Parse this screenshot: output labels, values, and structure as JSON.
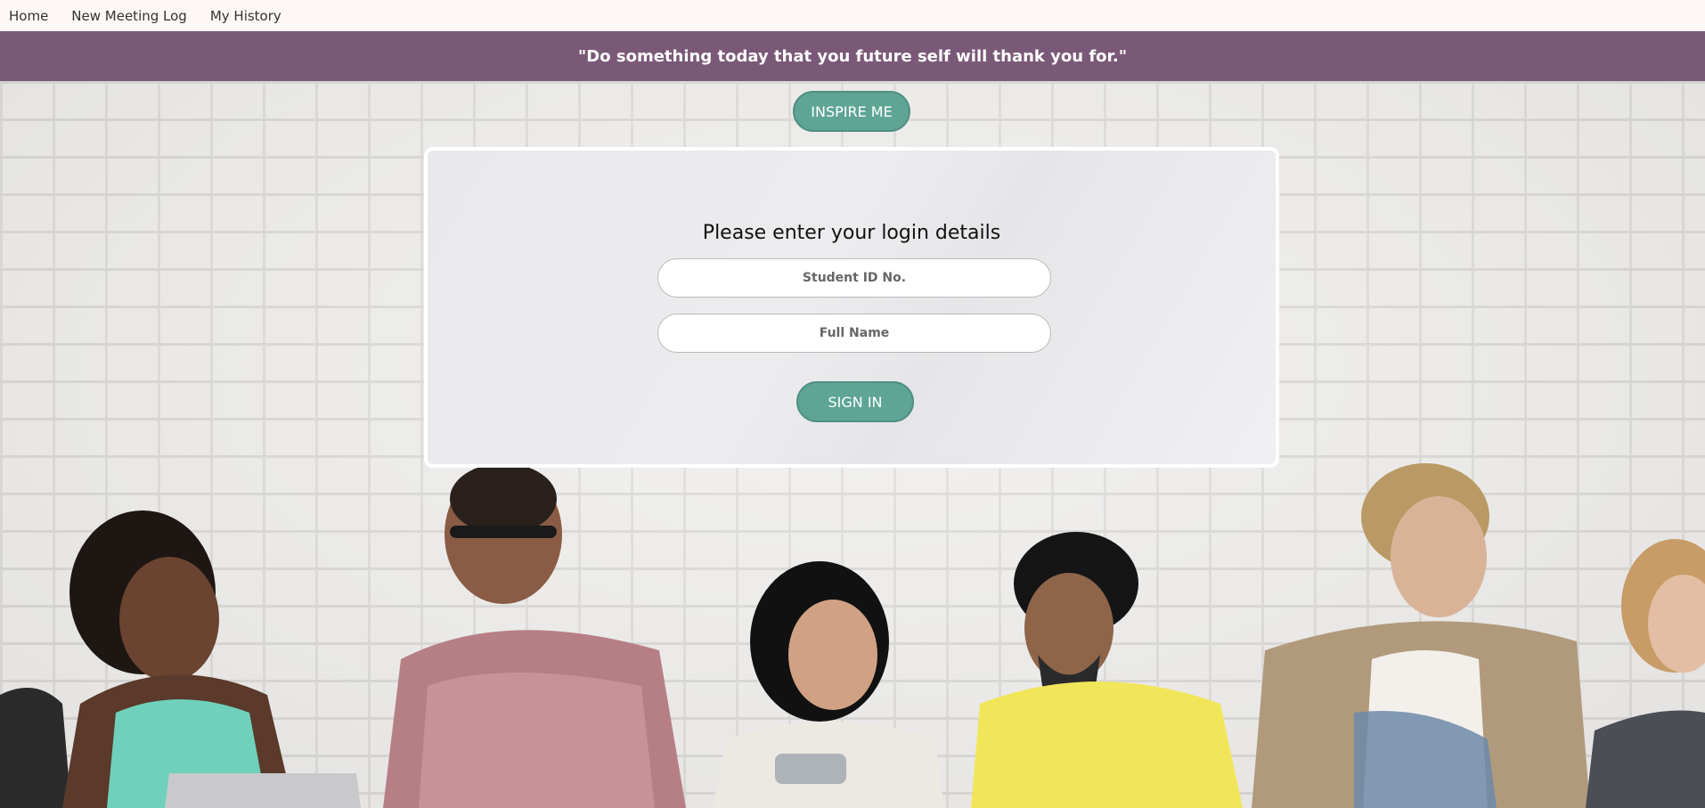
{
  "nav": {
    "items": [
      "Home",
      "New Meeting Log",
      "My History"
    ]
  },
  "quote": {
    "text": "\"Do something today that you future self will thank you for.\""
  },
  "inspire": {
    "label": "INSPIRE ME"
  },
  "login": {
    "title": "Please enter your login details",
    "student_id_placeholder": "Student ID No.",
    "full_name_placeholder": "Full Name",
    "sign_in_label": "SIGN IN"
  },
  "colors": {
    "banner": "#7a5978",
    "button": "#5fa596",
    "nav_bg": "#fdf8f6"
  }
}
